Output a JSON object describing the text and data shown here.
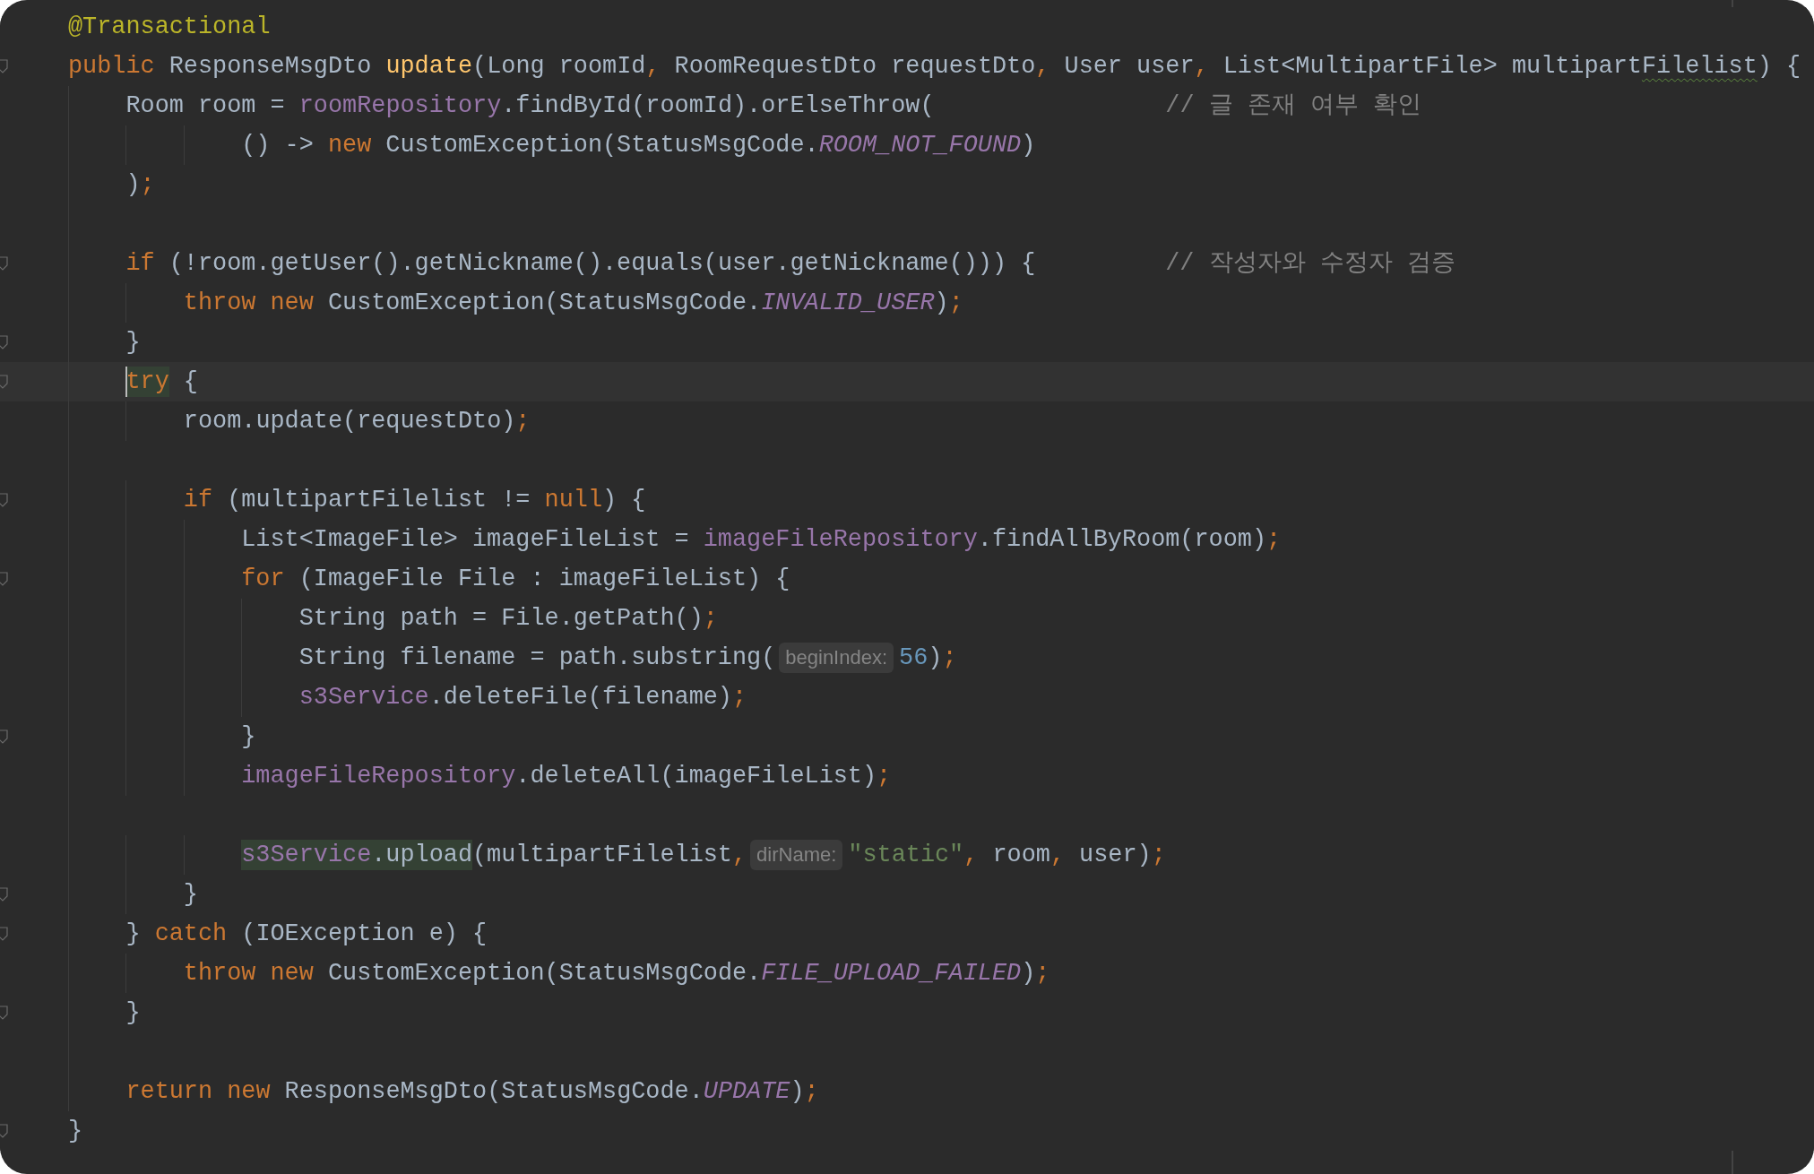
{
  "editor": {
    "lines": [
      {
        "current": false,
        "fold": false,
        "tokens": [
          {
            "kind": "ann",
            "t": "@Transactional"
          }
        ]
      },
      {
        "current": false,
        "fold": true,
        "tokens": [
          {
            "kind": "kw",
            "t": "public"
          },
          {
            "kind": "plain",
            "t": " ResponseMsgDto "
          },
          {
            "kind": "decl",
            "t": "update"
          },
          {
            "kind": "plain",
            "t": "(Long roomId"
          },
          {
            "kind": "punct",
            "t": ","
          },
          {
            "kind": "plain",
            "t": " RoomRequestDto requestDto"
          },
          {
            "kind": "punct",
            "t": ","
          },
          {
            "kind": "plain",
            "t": " User user"
          },
          {
            "kind": "punct",
            "t": ","
          },
          {
            "kind": "plain",
            "t": " List<MultipartFile> multipart"
          },
          {
            "kind": "plain",
            "t": "Filelist",
            "typo": true
          },
          {
            "kind": "plain",
            "t": ") {"
          }
        ]
      },
      {
        "current": false,
        "fold": false,
        "tokens": [
          {
            "kind": "plain",
            "t": "    Room room = "
          },
          {
            "kind": "field",
            "t": "roomRepository"
          },
          {
            "kind": "plain",
            "t": ".findById(roomId).orElseThrow(                "
          },
          {
            "kind": "cmt",
            "t": "// 글 존재 여부 확인"
          }
        ]
      },
      {
        "current": false,
        "fold": false,
        "tokens": [
          {
            "kind": "plain",
            "t": "            () -> "
          },
          {
            "kind": "kw",
            "t": "new"
          },
          {
            "kind": "plain",
            "t": " CustomException(StatusMsgCode."
          },
          {
            "kind": "const",
            "t": "ROOM_NOT_FOUND"
          },
          {
            "kind": "plain",
            "t": ")"
          }
        ]
      },
      {
        "current": false,
        "fold": false,
        "tokens": [
          {
            "kind": "plain",
            "t": "    )"
          },
          {
            "kind": "punct",
            "t": ";"
          }
        ]
      },
      {
        "current": false,
        "fold": false
      },
      {
        "current": false,
        "fold": true,
        "tokens": [
          {
            "kind": "kw",
            "t": "    if"
          },
          {
            "kind": "plain",
            "t": " (!room.getUser().getNickname().equals(user.getNickname())) {         "
          },
          {
            "kind": "cmt",
            "t": "// 작성자와 수정자 검증"
          }
        ]
      },
      {
        "current": false,
        "fold": false,
        "tokens": [
          {
            "kind": "kw",
            "t": "        throw new"
          },
          {
            "kind": "plain",
            "t": " CustomException(StatusMsgCode."
          },
          {
            "kind": "const",
            "t": "INVALID_USER"
          },
          {
            "kind": "plain",
            "t": ")"
          },
          {
            "kind": "punct",
            "t": ";"
          }
        ]
      },
      {
        "current": false,
        "fold": true,
        "tokens": [
          {
            "kind": "plain",
            "t": "    }"
          }
        ]
      },
      {
        "current": true,
        "fold": true,
        "tokens": [
          {
            "kind": "kw",
            "t": "    try",
            "match": true
          },
          {
            "kind": "plain",
            "t": " {"
          }
        ]
      },
      {
        "current": false,
        "fold": false,
        "tokens": [
          {
            "kind": "plain",
            "t": "        room.update(requestDto)"
          },
          {
            "kind": "punct",
            "t": ";"
          }
        ]
      },
      {
        "current": false,
        "fold": false
      },
      {
        "current": false,
        "fold": true,
        "tokens": [
          {
            "kind": "kw",
            "t": "        if"
          },
          {
            "kind": "plain",
            "t": " (multipartFilelist != "
          },
          {
            "kind": "kw",
            "t": "null"
          },
          {
            "kind": "plain",
            "t": ") {"
          }
        ]
      },
      {
        "current": false,
        "fold": false,
        "tokens": [
          {
            "kind": "plain",
            "t": "            List<ImageFile> imageFileList = "
          },
          {
            "kind": "field",
            "t": "imageFileRepository"
          },
          {
            "kind": "plain",
            "t": ".findAllByRoom(room)"
          },
          {
            "kind": "punct",
            "t": ";"
          }
        ]
      },
      {
        "current": false,
        "fold": true,
        "tokens": [
          {
            "kind": "kw",
            "t": "            for"
          },
          {
            "kind": "plain",
            "t": " (ImageFile File : imageFileList) {"
          }
        ]
      },
      {
        "current": false,
        "fold": false,
        "tokens": [
          {
            "kind": "plain",
            "t": "                String path = File.getPath()"
          },
          {
            "kind": "punct",
            "t": ";"
          }
        ]
      },
      {
        "current": false,
        "fold": false,
        "tokens": [
          {
            "kind": "plain",
            "t": "                String filename = path.substring("
          },
          {
            "kind": "hint",
            "t": "beginIndex:"
          },
          {
            "kind": "num",
            "t": "56"
          },
          {
            "kind": "plain",
            "t": ")"
          },
          {
            "kind": "punct",
            "t": ";"
          }
        ]
      },
      {
        "current": false,
        "fold": false,
        "tokens": [
          {
            "kind": "field",
            "t": "                s3Service"
          },
          {
            "kind": "plain",
            "t": ".deleteFile(filename)"
          },
          {
            "kind": "punct",
            "t": ";"
          }
        ]
      },
      {
        "current": false,
        "fold": true,
        "tokens": [
          {
            "kind": "plain",
            "t": "            }"
          }
        ]
      },
      {
        "current": false,
        "fold": false,
        "tokens": [
          {
            "kind": "field",
            "t": "            imageFileRepository"
          },
          {
            "kind": "plain",
            "t": ".deleteAll(imageFileList)"
          },
          {
            "kind": "punct",
            "t": ";"
          }
        ]
      },
      {
        "current": false,
        "fold": false
      },
      {
        "current": false,
        "fold": false,
        "tokens": [
          {
            "kind": "field",
            "t": "            s3Service",
            "match": true
          },
          {
            "kind": "plain",
            "t": ".upload",
            "match": true
          },
          {
            "kind": "plain",
            "t": "(multipartFilelist"
          },
          {
            "kind": "punct",
            "t": ","
          },
          {
            "kind": "hint",
            "t": "dirName:"
          },
          {
            "kind": "str",
            "t": "\"static\""
          },
          {
            "kind": "punct",
            "t": ","
          },
          {
            "kind": "plain",
            "t": " room"
          },
          {
            "kind": "punct",
            "t": ","
          },
          {
            "kind": "plain",
            "t": " user)"
          },
          {
            "kind": "punct",
            "t": ";"
          }
        ]
      },
      {
        "current": false,
        "fold": true,
        "tokens": [
          {
            "kind": "plain",
            "t": "        }"
          }
        ]
      },
      {
        "current": false,
        "fold": true,
        "tokens": [
          {
            "kind": "plain",
            "t": "    } "
          },
          {
            "kind": "kw",
            "t": "catch"
          },
          {
            "kind": "plain",
            "t": " (IOException e) {"
          }
        ]
      },
      {
        "current": false,
        "fold": false,
        "tokens": [
          {
            "kind": "kw",
            "t": "        throw new"
          },
          {
            "kind": "plain",
            "t": " CustomException(StatusMsgCode."
          },
          {
            "kind": "const",
            "t": "FILE_UPLOAD_FAILED"
          },
          {
            "kind": "plain",
            "t": ")"
          },
          {
            "kind": "punct",
            "t": ";"
          }
        ]
      },
      {
        "current": false,
        "fold": true,
        "tokens": [
          {
            "kind": "plain",
            "t": "    }"
          }
        ]
      },
      {
        "current": false,
        "fold": false
      },
      {
        "current": false,
        "fold": false,
        "tokens": [
          {
            "kind": "kw",
            "t": "    return new"
          },
          {
            "kind": "plain",
            "t": " ResponseMsgDto(StatusMsgCode."
          },
          {
            "kind": "const",
            "t": "UPDATE"
          },
          {
            "kind": "plain",
            "t": ")"
          },
          {
            "kind": "punct",
            "t": ";"
          }
        ]
      },
      {
        "current": false,
        "fold": true,
        "tokens": [
          {
            "kind": "plain",
            "t": "}"
          }
        ]
      }
    ]
  }
}
